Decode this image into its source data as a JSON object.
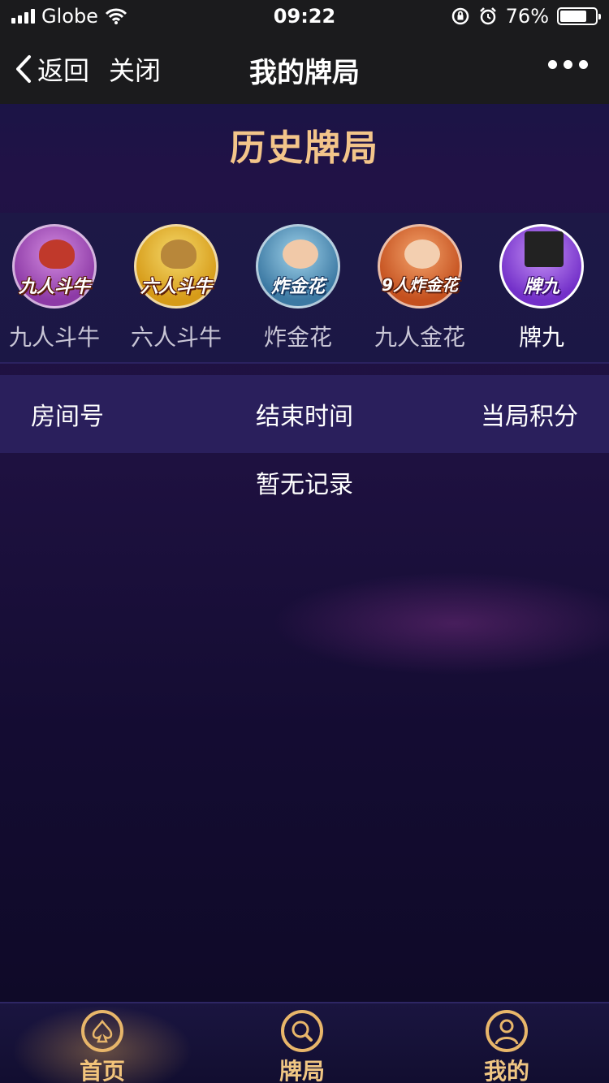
{
  "status_bar": {
    "carrier": "Globe",
    "time": "09:22",
    "battery": "76%",
    "battery_level": 0.76
  },
  "nav": {
    "back_label": "返回",
    "close_label": "关闭",
    "title": "我的牌局"
  },
  "section_title": "历史牌局",
  "games": [
    {
      "label": "九人斗牛",
      "icon": "nine-player-bull-icon",
      "tag": "九人斗牛",
      "color": "#a04bb8"
    },
    {
      "label": "六人斗牛",
      "icon": "six-player-bull-icon",
      "tag": "六人斗牛",
      "color": "#e0b52a"
    },
    {
      "label": "炸金花",
      "icon": "zha-jin-hua-icon",
      "tag": "炸金花",
      "color": "#4f8db5"
    },
    {
      "label": "九人金花",
      "icon": "nine-player-jin-hua-icon",
      "tag": "9人炸金花",
      "color": "#d9652a"
    },
    {
      "label": "牌九",
      "icon": "pai-gow-icon",
      "tag": "牌九",
      "color": "#8a3fd6"
    }
  ],
  "selected_game": "牌九",
  "table": {
    "columns": [
      "房间号",
      "结束时间",
      "当局积分"
    ],
    "empty_text": "暂无记录"
  },
  "tabs": [
    {
      "label": "首页",
      "icon": "spade-icon"
    },
    {
      "label": "牌局",
      "icon": "search-icon"
    },
    {
      "label": "我的",
      "icon": "user-icon"
    }
  ],
  "colors": {
    "accent": "#f3c58a",
    "header_bg": "#2a1f5c"
  }
}
